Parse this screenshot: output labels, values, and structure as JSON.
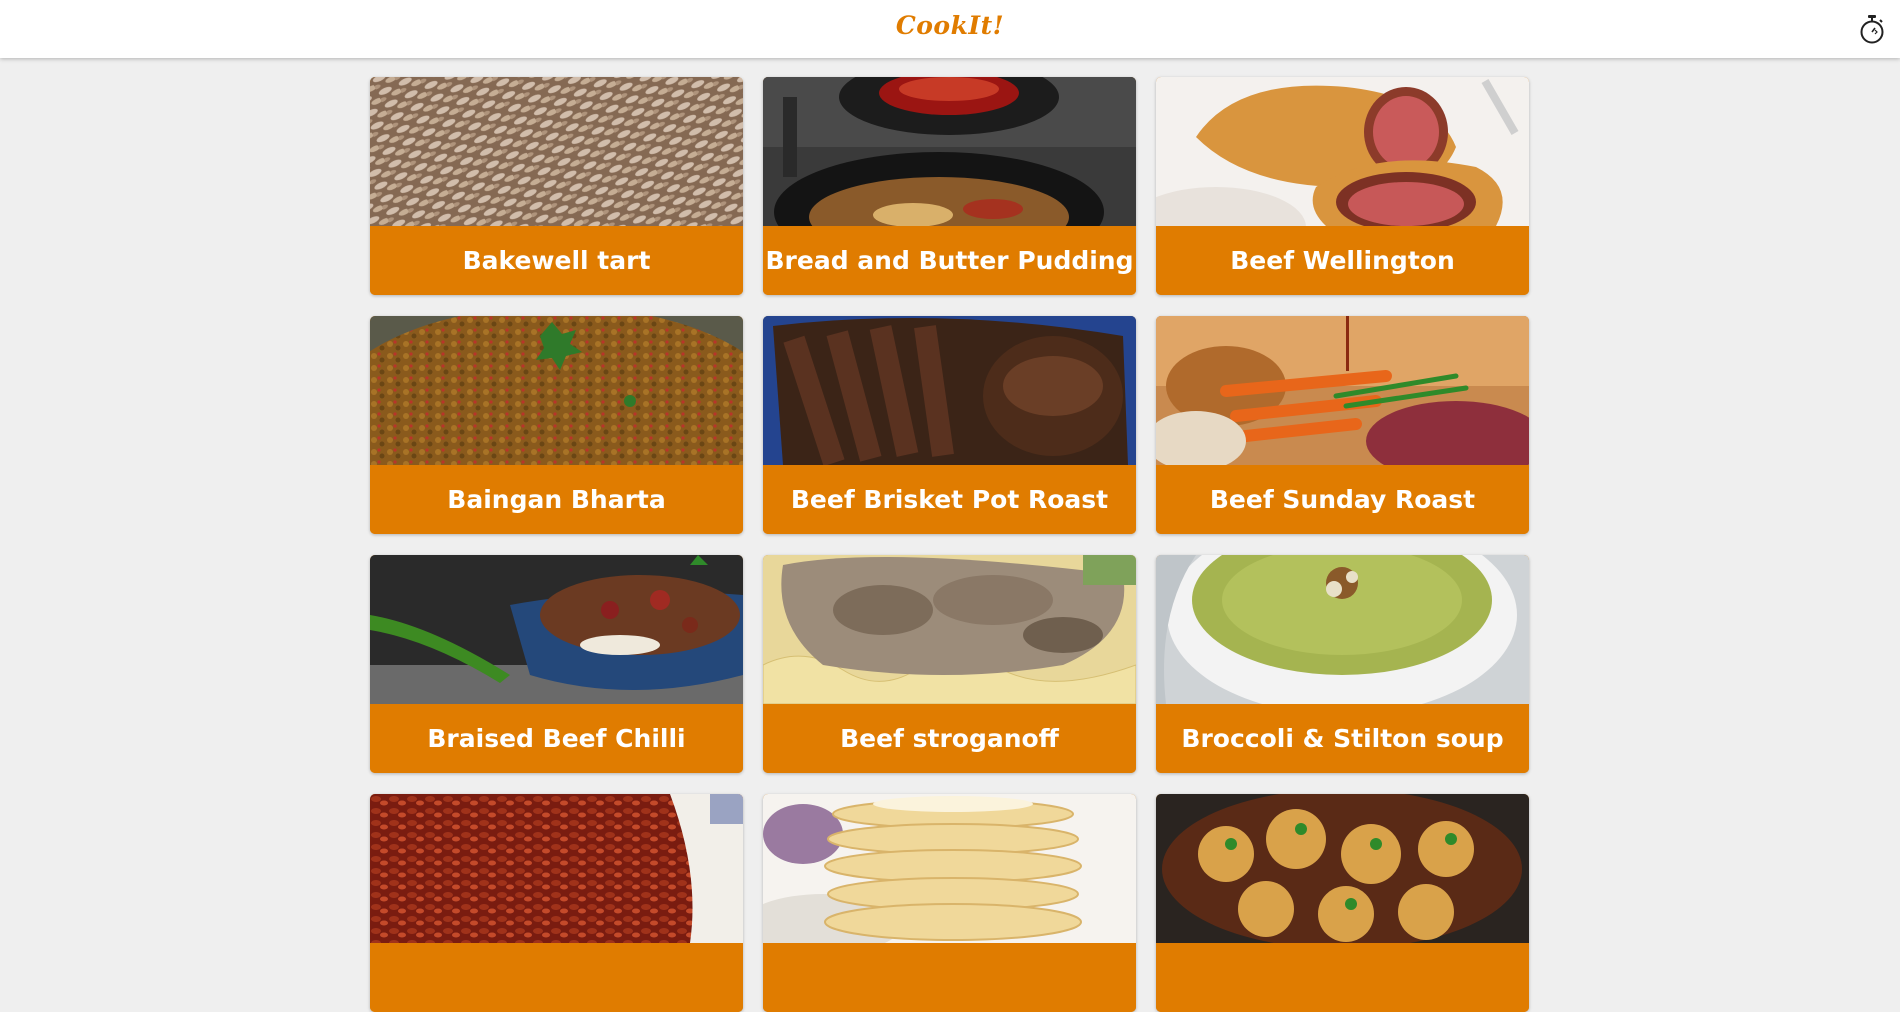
{
  "header": {
    "brand": "CookIt!",
    "timer_icon": "stopwatch-icon"
  },
  "colors": {
    "accent": "#e07c00",
    "background": "#efefef",
    "header_bg": "#ffffff"
  },
  "recipes": [
    {
      "title": "Bakewell tart",
      "image": "almond-tart-photo"
    },
    {
      "title": "Bread and Butter Pudding",
      "image": "pudding-skillet-photo"
    },
    {
      "title": "Beef Wellington",
      "image": "beef-wellington-photo"
    },
    {
      "title": "Baingan Bharta",
      "image": "eggplant-curry-photo"
    },
    {
      "title": "Beef Brisket Pot Roast",
      "image": "sliced-brisket-photo"
    },
    {
      "title": "Beef Sunday Roast",
      "image": "roast-vegetables-photo"
    },
    {
      "title": "Braised Beef Chilli",
      "image": "chilli-bowl-photo"
    },
    {
      "title": "Beef stroganoff",
      "image": "stroganoff-noodles-photo"
    },
    {
      "title": "Broccoli & Stilton soup",
      "image": "broccoli-soup-photo"
    },
    {
      "title": "",
      "image": "baked-beans-photo"
    },
    {
      "title": "",
      "image": "pancake-stack-photo"
    },
    {
      "title": "",
      "image": "stew-dumplings-photo"
    }
  ]
}
